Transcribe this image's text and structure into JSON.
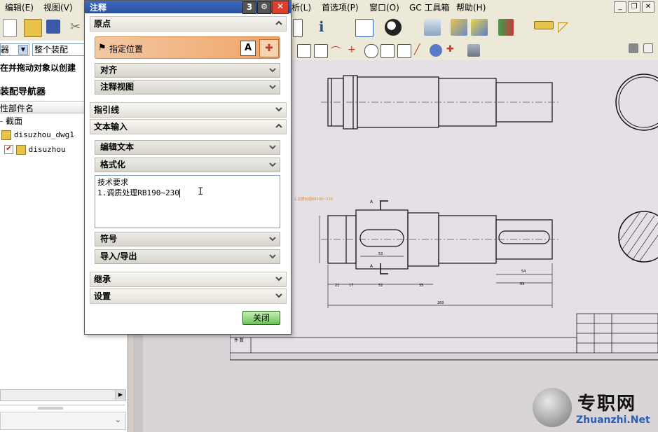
{
  "menubar": {
    "items": [
      "编辑(E)",
      "视图(V)",
      "析(L)",
      "首选项(P)",
      "窗口(O)",
      "GC 工具箱",
      "帮助(H)"
    ]
  },
  "left_panel": {
    "filter_left": "器",
    "filter_right": "整个装配",
    "hint": "在并拖动对象以创建",
    "title": "装配导航器",
    "column_header": "性部件名",
    "rows": [
      "截面",
      "disuzhou_dwg1",
      "disuzhou"
    ]
  },
  "dialog": {
    "title": "注释",
    "title_badge": "3",
    "origin": {
      "label": "原点",
      "specify_position": "指定位置",
      "align": "对齐",
      "annotation_view": "注释视图"
    },
    "leader": "指引线",
    "text_input": {
      "label": "文本输入",
      "edit_text": "编辑文本",
      "format": "格式化",
      "text_line1": "技术要求",
      "text_line2": "1.调质处理RB190~230",
      "symbol": "符号",
      "import_export": "导入/导出"
    },
    "inherit": "继承",
    "settings": "设置",
    "close_label": "关闭"
  },
  "drawing": {
    "dims_bottom": [
      "21",
      "17",
      "52",
      "35",
      "69"
    ],
    "dim_total": "260",
    "dim_key1": "53",
    "dim_key2": "54",
    "section_A": "A",
    "table_label": "件 数"
  },
  "watermark": {
    "cn": "专职网",
    "en": "Zhuanzhi.Net"
  },
  "colors": {
    "dialog_highlight": "#f0a468",
    "title_blue": "#2a4f9c",
    "close_green": "#6cc35a"
  }
}
